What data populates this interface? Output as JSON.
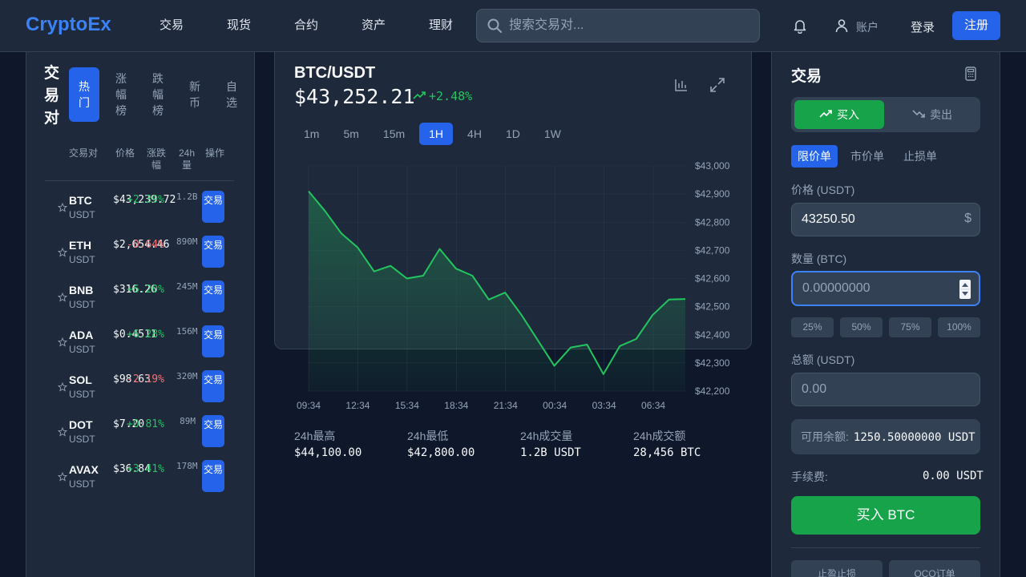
{
  "brand": "CryptoEx",
  "nav": [
    "交易",
    "现货",
    "合约",
    "资产",
    "理财"
  ],
  "search": {
    "placeholder": "搜索交易对..."
  },
  "account_label": "账户",
  "login_label": "登录",
  "register_label": "注册",
  "pairs_panel": {
    "title": "交易对",
    "tabs": [
      "热门",
      "涨幅榜",
      "跌幅榜",
      "新币",
      "自选"
    ],
    "active_tab": 0,
    "columns": [
      "交易对",
      "价格",
      "涨跌幅",
      "24h量",
      "操作"
    ],
    "trade_label": "交易",
    "rows": [
      {
        "symbol": "BTC",
        "quote": "USDT",
        "price": "$43,239.72",
        "change": "+2.39%",
        "volume": "1.2B",
        "up": true
      },
      {
        "symbol": "ETH",
        "quote": "USDT",
        "price": "$2,654.46",
        "change": "-0.64%",
        "volume": "890M",
        "up": false
      },
      {
        "symbol": "BNB",
        "quote": "USDT",
        "price": "$316.26",
        "change": "+6.20%",
        "volume": "245M",
        "up": true
      },
      {
        "symbol": "ADA",
        "quote": "USDT",
        "price": "$0.4511",
        "change": "+6.28%",
        "volume": "156M",
        "up": true
      },
      {
        "symbol": "SOL",
        "quote": "USDT",
        "price": "$98.63",
        "change": "-2.19%",
        "volume": "320M",
        "up": false
      },
      {
        "symbol": "DOT",
        "quote": "USDT",
        "price": "$7.20",
        "change": "+0.81%",
        "volume": "89M",
        "up": true
      },
      {
        "symbol": "AVAX",
        "quote": "USDT",
        "price": "$36.84",
        "change": "+3.41%",
        "volume": "178M",
        "up": true
      }
    ]
  },
  "chart_panel": {
    "pair": "BTC/USDT",
    "price": "$43,252.21",
    "change": "+2.48%",
    "intervals": [
      "1m",
      "5m",
      "15m",
      "1H",
      "4H",
      "1D",
      "1W"
    ],
    "active_interval": 3,
    "stats": [
      {
        "label": "24h最高",
        "value": "$44,100.00"
      },
      {
        "label": "24h最低",
        "value": "$42,800.00"
      },
      {
        "label": "24h成交量",
        "value": "1.2B USDT"
      },
      {
        "label": "24h成交额",
        "value": "28,456 BTC"
      }
    ]
  },
  "chart_data": {
    "type": "area",
    "x_labels": [
      "09:34",
      "12:34",
      "15:34",
      "18:34",
      "21:34",
      "00:34",
      "03:34",
      "06:34"
    ],
    "y_ticks": [
      "$43,000",
      "$42,900",
      "$42,800",
      "$42,700",
      "$42,600",
      "$42,500",
      "$42,400",
      "$42,300",
      "$42,200"
    ],
    "ylim": [
      42200,
      43000
    ],
    "values": [
      42910,
      42840,
      42760,
      42710,
      42625,
      42645,
      42600,
      42610,
      42705,
      42635,
      42610,
      42525,
      42550,
      42470,
      42380,
      42290,
      42355,
      42365,
      42260,
      42360,
      42385,
      42470,
      42525,
      42527
    ],
    "color": "#22c55e",
    "grid": true
  },
  "trade_panel": {
    "title": "交易",
    "buy_label": "买入",
    "sell_label": "卖出",
    "order_types": [
      "限价单",
      "市价单",
      "止损单"
    ],
    "active_order_type": 0,
    "price_label": "价格 (USDT)",
    "price_value": "43250.50",
    "price_unit_icon": "$",
    "amount_label": "数量 (BTC)",
    "amount_placeholder": "0.00000000",
    "percents": [
      "25%",
      "50%",
      "75%",
      "100%"
    ],
    "total_label": "总额 (USDT)",
    "total_placeholder": "0.00",
    "available_label": "可用余额:",
    "available_value": "1250.50000000 USDT",
    "fee_label": "手续费:",
    "fee_value": "0.00 USDT",
    "submit_label": "买入 BTC",
    "advanced": [
      "止盈止损",
      "OCO订单"
    ]
  },
  "colors": {
    "accent": "#2563eb",
    "up": "#22c55e",
    "down": "#f87171",
    "brand": "#3b82f6"
  }
}
